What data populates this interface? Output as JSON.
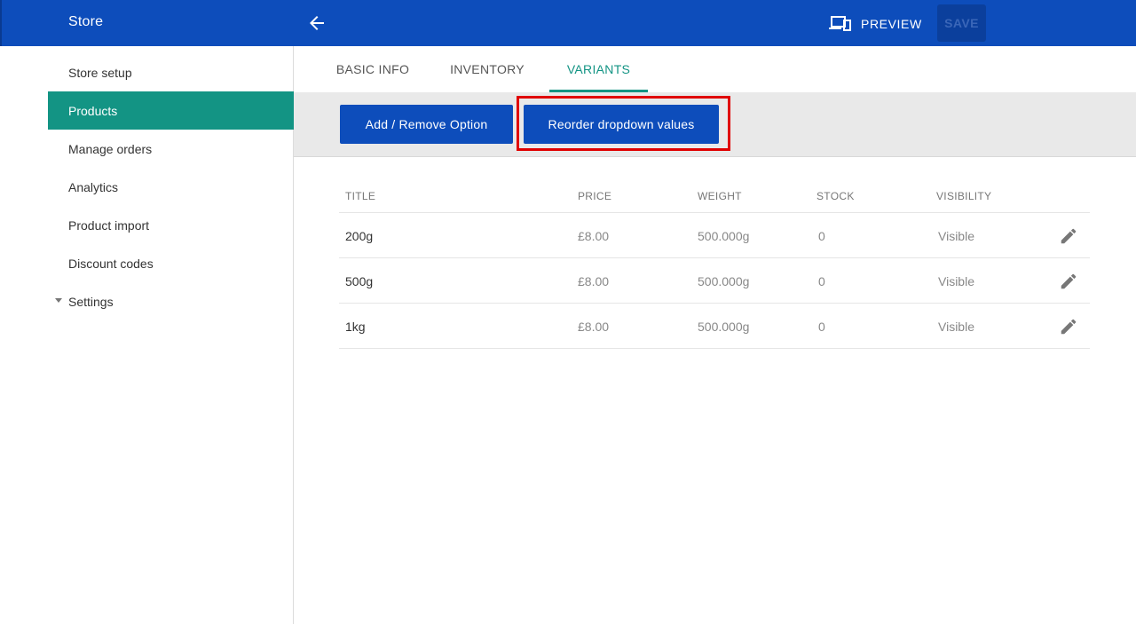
{
  "header": {
    "title": "Store",
    "back_icon": "arrow-left-icon",
    "preview_label": "PREVIEW",
    "preview_icon": "devices-icon",
    "save_label": "SAVE"
  },
  "sidebar": {
    "items": [
      {
        "label": "Store setup",
        "active": false
      },
      {
        "label": "Products",
        "active": true
      },
      {
        "label": "Manage orders",
        "active": false
      },
      {
        "label": "Analytics",
        "active": false
      },
      {
        "label": "Product import",
        "active": false
      },
      {
        "label": "Discount codes",
        "active": false
      }
    ],
    "settings_label": "Settings"
  },
  "tabs": [
    {
      "label": "BASIC INFO",
      "active": false
    },
    {
      "label": "INVENTORY",
      "active": false
    },
    {
      "label": "VARIANTS",
      "active": true
    }
  ],
  "actions": {
    "add_remove_label": "Add / Remove Option",
    "reorder_label": "Reorder dropdown values"
  },
  "table": {
    "columns": [
      "TITLE",
      "PRICE",
      "WEIGHT",
      "STOCK",
      "VISIBILITY"
    ],
    "rows": [
      {
        "title": "200g",
        "price": "£8.00",
        "weight": "500.000g",
        "stock": "0",
        "visibility": "Visible"
      },
      {
        "title": "500g",
        "price": "£8.00",
        "weight": "500.000g",
        "stock": "0",
        "visibility": "Visible"
      },
      {
        "title": "1kg",
        "price": "£8.00",
        "weight": "500.000g",
        "stock": "0",
        "visibility": "Visible"
      }
    ]
  },
  "colors": {
    "primary": "#0d4dbb",
    "accent": "#139484",
    "highlight": "#e00000"
  }
}
